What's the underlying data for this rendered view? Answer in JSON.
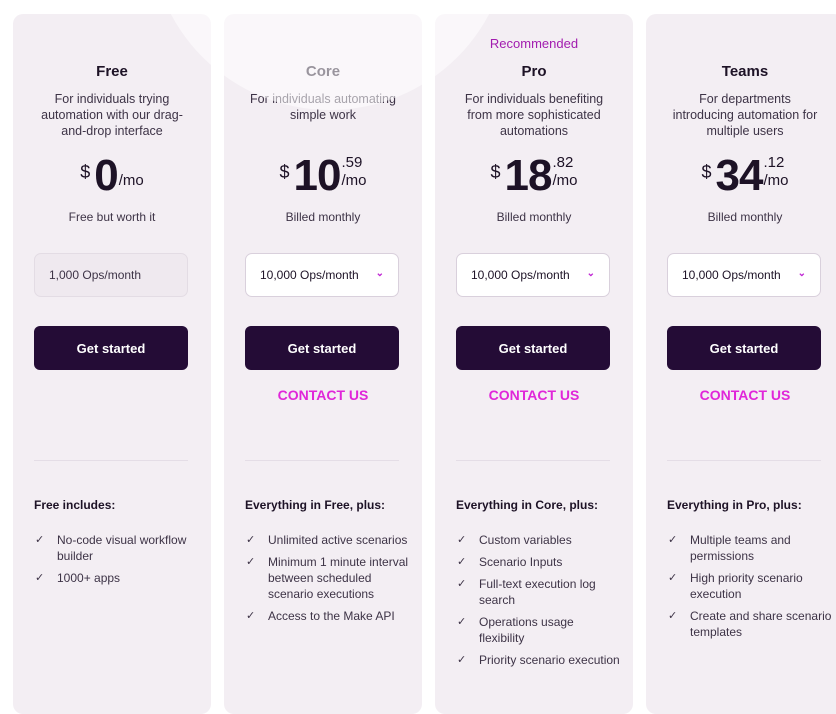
{
  "plans": [
    {
      "recommended": "",
      "name": "Free",
      "description": "For individuals trying automation with our drag-and-drop interface",
      "currency": "$",
      "price_int": "0",
      "price_cents": "",
      "per": "/mo",
      "billing": "Free but worth it",
      "ops": "1,000 Ops/month",
      "cta": "Get started",
      "contact": "",
      "includes_title": "Free includes:",
      "features": [
        "No-code visual workflow builder",
        "1000+ apps"
      ]
    },
    {
      "recommended": "",
      "name": "Core",
      "description": "For individuals automating simple work",
      "currency": "$",
      "price_int": "10",
      "price_cents": ".59",
      "per": "/mo",
      "billing": "Billed monthly",
      "ops": "10,000 Ops/month",
      "cta": "Get started",
      "contact": "CONTACT US",
      "includes_title": "Everything in Free, plus:",
      "features": [
        "Unlimited active scenarios",
        "Minimum 1 minute interval between scheduled scenario executions",
        "Access to the Make API"
      ]
    },
    {
      "recommended": "Recommended",
      "name": "Pro",
      "description": "For individuals benefiting from more sophisticated automations",
      "currency": "$",
      "price_int": "18",
      "price_cents": ".82",
      "per": "/mo",
      "billing": "Billed monthly",
      "ops": "10,000 Ops/month",
      "cta": "Get started",
      "contact": "CONTACT US",
      "includes_title": "Everything in Core, plus:",
      "features": [
        "Custom variables",
        "Scenario Inputs",
        "Full-text execution log search",
        "Operations usage flexibility",
        "Priority scenario execution"
      ]
    },
    {
      "recommended": "",
      "name": "Teams",
      "description": "For departments introducing automation for multiple users",
      "currency": "$",
      "price_int": "34",
      "price_cents": ".12",
      "per": "/mo",
      "billing": "Billed monthly",
      "ops": "10,000 Ops/month",
      "cta": "Get started",
      "contact": "CONTACT US",
      "includes_title": "Everything in Pro, plus:",
      "features": [
        "Multiple teams and permissions",
        "High priority scenario execution",
        "Create and share scenario templates"
      ]
    }
  ],
  "icons": {
    "check": "check-icon",
    "chevron": "chevron-down-icon"
  },
  "colors": {
    "cta_bg": "#240c36",
    "contact": "#e026d9",
    "recommended": "#a21caf",
    "card_bg": "#f3eef3"
  }
}
